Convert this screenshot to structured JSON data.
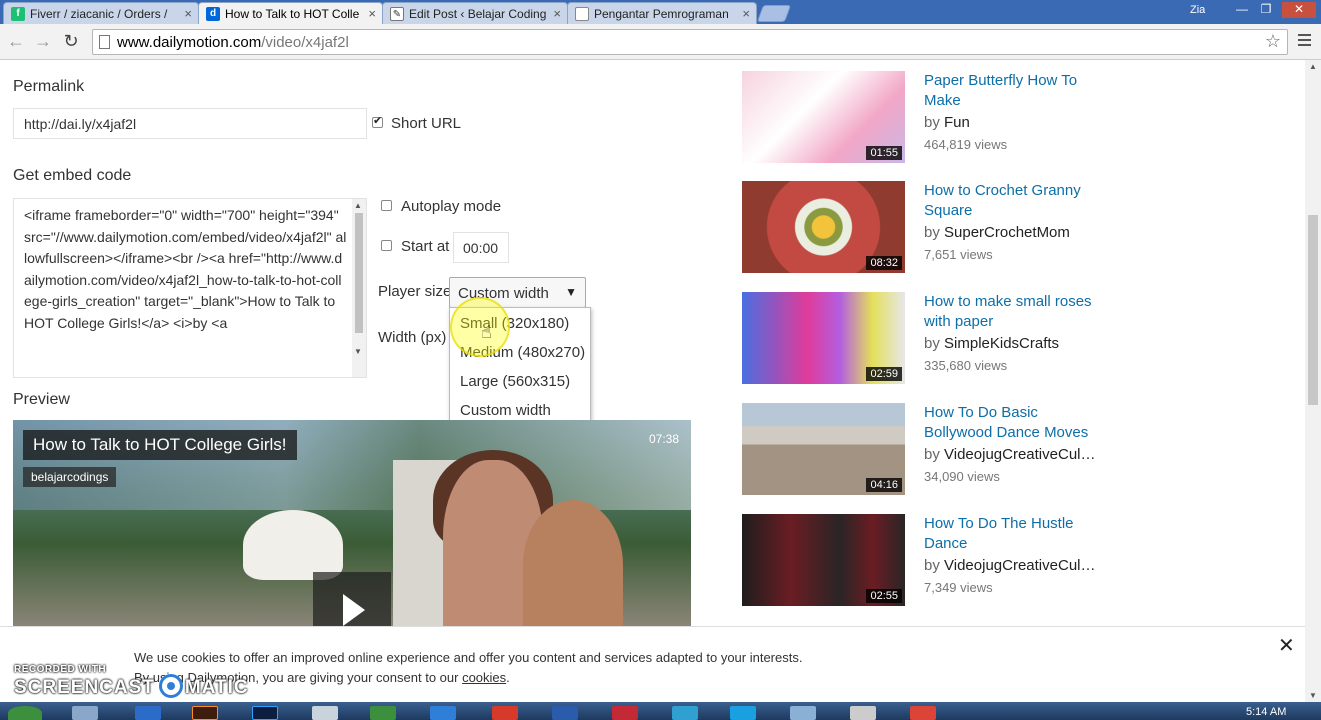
{
  "browser": {
    "tabs": [
      {
        "label": "Fiverr / ziacanic / Orders /",
        "icon": "fiverr-icon"
      },
      {
        "label": "How to Talk to HOT Colle",
        "icon": "dailymotion-icon"
      },
      {
        "label": "Edit Post ‹ Belajar Coding",
        "icon": "wordpress-icon"
      },
      {
        "label": "Pengantar Pemrograman",
        "icon": "page-icon"
      }
    ],
    "window_user": "Zia",
    "url_host": "www.dailymotion.com",
    "url_path": "/video/x4jaf2l"
  },
  "share": {
    "permalink_label": "Permalink",
    "permalink_value": "http://dai.ly/x4jaf2l",
    "short_url_label": "Short URL",
    "embed_label": "Get embed code",
    "embed_code": "<iframe frameborder=\"0\" width=\"700\" height=\"394\" src=\"//www.dailymotion.com/embed/video/x4jaf2l\" allowfullscreen></iframe><br /><a href=\"http://www.dailymotion.com/video/x4jaf2l_how-to-talk-to-hot-college-girls_creation\" target=\"_blank\">How to Talk to HOT College Girls!</a> <i>by <a",
    "autoplay_label": "Autoplay mode",
    "start_at_label": "Start at",
    "start_at_value": "00:00",
    "player_size_label": "Player size",
    "player_size_value": "Custom width",
    "width_label": "Width (px)",
    "size_options": [
      "Small (320x180)",
      "Medium (480x270)",
      "Large (560x315)",
      "Custom width"
    ],
    "preview_label": "Preview"
  },
  "video": {
    "title": "How to Talk to HOT College Girls!",
    "channel": "belajarcodings",
    "duration": "07:38"
  },
  "related": [
    {
      "title": "Paper Butterfly How To Make",
      "by": "by",
      "author": "Fun",
      "views": "464,819 views",
      "duration": "01:55"
    },
    {
      "title": "How to Crochet Granny Square",
      "by": "by",
      "author": "SuperCrochetMom",
      "views": "7,651 views",
      "duration": "08:32"
    },
    {
      "title": "How to make small roses with paper",
      "by": "by",
      "author": "SimpleKidsCrafts",
      "views": "335,680 views",
      "duration": "02:59"
    },
    {
      "title": "How To Do Basic Bollywood Dance Moves",
      "by": "by",
      "author": "VideojugCreativeCul…",
      "views": "34,090 views",
      "duration": "04:16"
    },
    {
      "title": "How To Do The Hustle Dance",
      "by": "by",
      "author": "VideojugCreativeCul…",
      "views": "7,349 views",
      "duration": "02:55"
    }
  ],
  "cookie": {
    "line1": "We use cookies to offer an improved online experience and offer you content and services adapted to your interests.",
    "line2": "By using Dailymotion, you are giving your consent to our",
    "link": "cookies",
    "end": "."
  },
  "watermark": {
    "recorded": "RECORDED WITH",
    "left": "SCREENCAST",
    "right": "MATIC"
  },
  "taskbar": {
    "clock": "5:14 AM"
  },
  "colors": {
    "link": "#0d6ea8",
    "tabstrip": "#3b6ab5",
    "highlight": "#ffff00"
  }
}
